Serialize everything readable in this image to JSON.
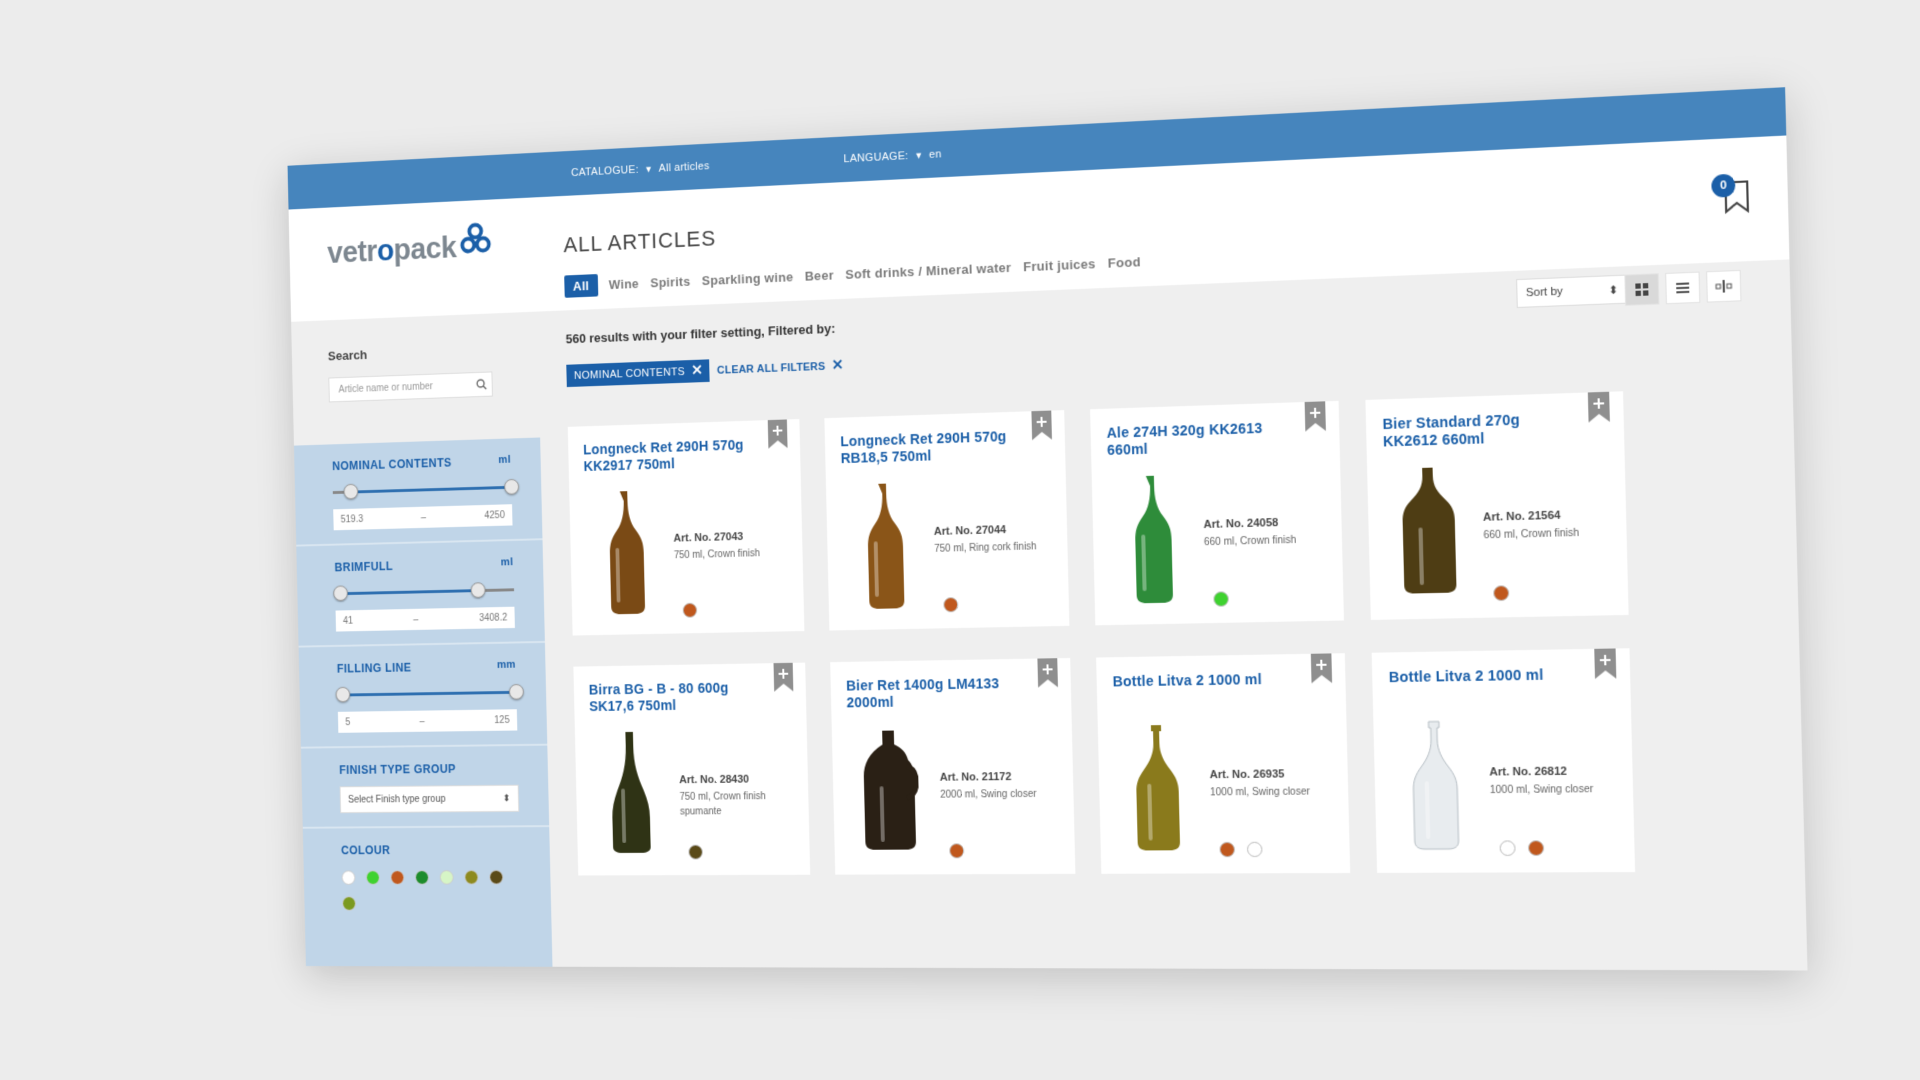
{
  "topbar": {
    "catalogue_label": "CATALOGUE:",
    "catalogue_value": "All articles",
    "language_label": "LANGUAGE:",
    "language_value": "en"
  },
  "header": {
    "logo_prefix": "vetr",
    "logo_o": "o",
    "logo_suffix": "pack",
    "title": "ALL ARTICLES",
    "bookmark_count": "0",
    "tabs": [
      {
        "label": "All",
        "active": true
      },
      {
        "label": "Wine"
      },
      {
        "label": "Spirits"
      },
      {
        "label": "Sparkling wine"
      },
      {
        "label": "Beer"
      },
      {
        "label": "Soft drinks / Mineral water"
      },
      {
        "label": "Fruit juices"
      },
      {
        "label": "Food"
      }
    ]
  },
  "search": {
    "label": "Search",
    "placeholder": "Article name or number"
  },
  "filters": {
    "nominal": {
      "label": "NOMINAL CONTENTS",
      "unit": "ml",
      "min": "519.3",
      "sep": "–",
      "max": "4250"
    },
    "brimfull": {
      "label": "BRIMFULL",
      "unit": "ml",
      "min": "41",
      "sep": "–",
      "max": "3408.2"
    },
    "filling": {
      "label": "FILLING LINE",
      "unit": "mm",
      "min": "5",
      "sep": "–",
      "max": "125"
    },
    "finish": {
      "label": "FINISH TYPE GROUP",
      "select_placeholder": "Select Finish type group"
    },
    "colour": {
      "label": "COLOUR",
      "swatches": [
        "#ffffff",
        "#3fd230",
        "#c0581d",
        "#1c8c2c",
        "#d6f5c6",
        "#8d8a1f",
        "#5a4a18",
        "#7b9a20"
      ]
    }
  },
  "results": {
    "text": "560 results with your filter setting, Filtered by:",
    "chip": "NOMINAL CONTENTS",
    "clear": "CLEAR ALL FILTERS",
    "sort_label": "Sort by"
  },
  "products": [
    {
      "name": "Longneck Ret 290H 570g KK2917 750ml",
      "art": "Art. No. 27043",
      "desc": "750 ml, Crown finish",
      "colors": [
        "#c0581d"
      ],
      "glass": "#7a4a15",
      "shape": "longneck"
    },
    {
      "name": "Longneck Ret 290H 570g RB18,5 750ml",
      "art": "Art. No. 27044",
      "desc": "750 ml, Ring cork finish",
      "colors": [
        "#c0581d"
      ],
      "glass": "#8a5518",
      "shape": "longneck"
    },
    {
      "name": "Ale 274H 320g KK2613 660ml",
      "art": "Art. No. 24058",
      "desc": "660 ml, Crown finish",
      "colors": [
        "#3fd230"
      ],
      "glass": "#2e8c3a",
      "shape": "longneck"
    },
    {
      "name": "Bier Standard 270g KK2612 660ml",
      "art": "Art. No. 21564",
      "desc": "660 ml, Crown finish",
      "colors": [
        "#c0581d"
      ],
      "glass": "#4e3d14",
      "shape": "standard"
    },
    {
      "name": "Birra BG - B - 80 600g SK17,6 750ml",
      "art": "Art. No. 28430",
      "desc": "750 ml, Crown finish spumante",
      "colors": [
        "#5a4a18"
      ],
      "glass": "#2f3315",
      "shape": "champagne"
    },
    {
      "name": "Bier Ret 1400g LM4133 2000ml",
      "art": "Art. No. 21172",
      "desc": "2000 ml, Swing closer",
      "colors": [
        "#c0581d"
      ],
      "glass": "#2a2015",
      "shape": "growler"
    },
    {
      "name": "Bottle Litva 2 1000 ml",
      "art": "Art. No. 26935",
      "desc": "1000 ml, Swing closer",
      "colors": [
        "#c0581d",
        "#ffffff"
      ],
      "glass": "#8a7a1c",
      "shape": "litva"
    },
    {
      "name": "Bottle Litva 2 1000 ml",
      "art": "Art. No. 26812",
      "desc": "1000 ml, Swing closer",
      "colors": [
        "#ffffff",
        "#c0581d"
      ],
      "glass": "#e8ecef",
      "shape": "litva"
    }
  ]
}
